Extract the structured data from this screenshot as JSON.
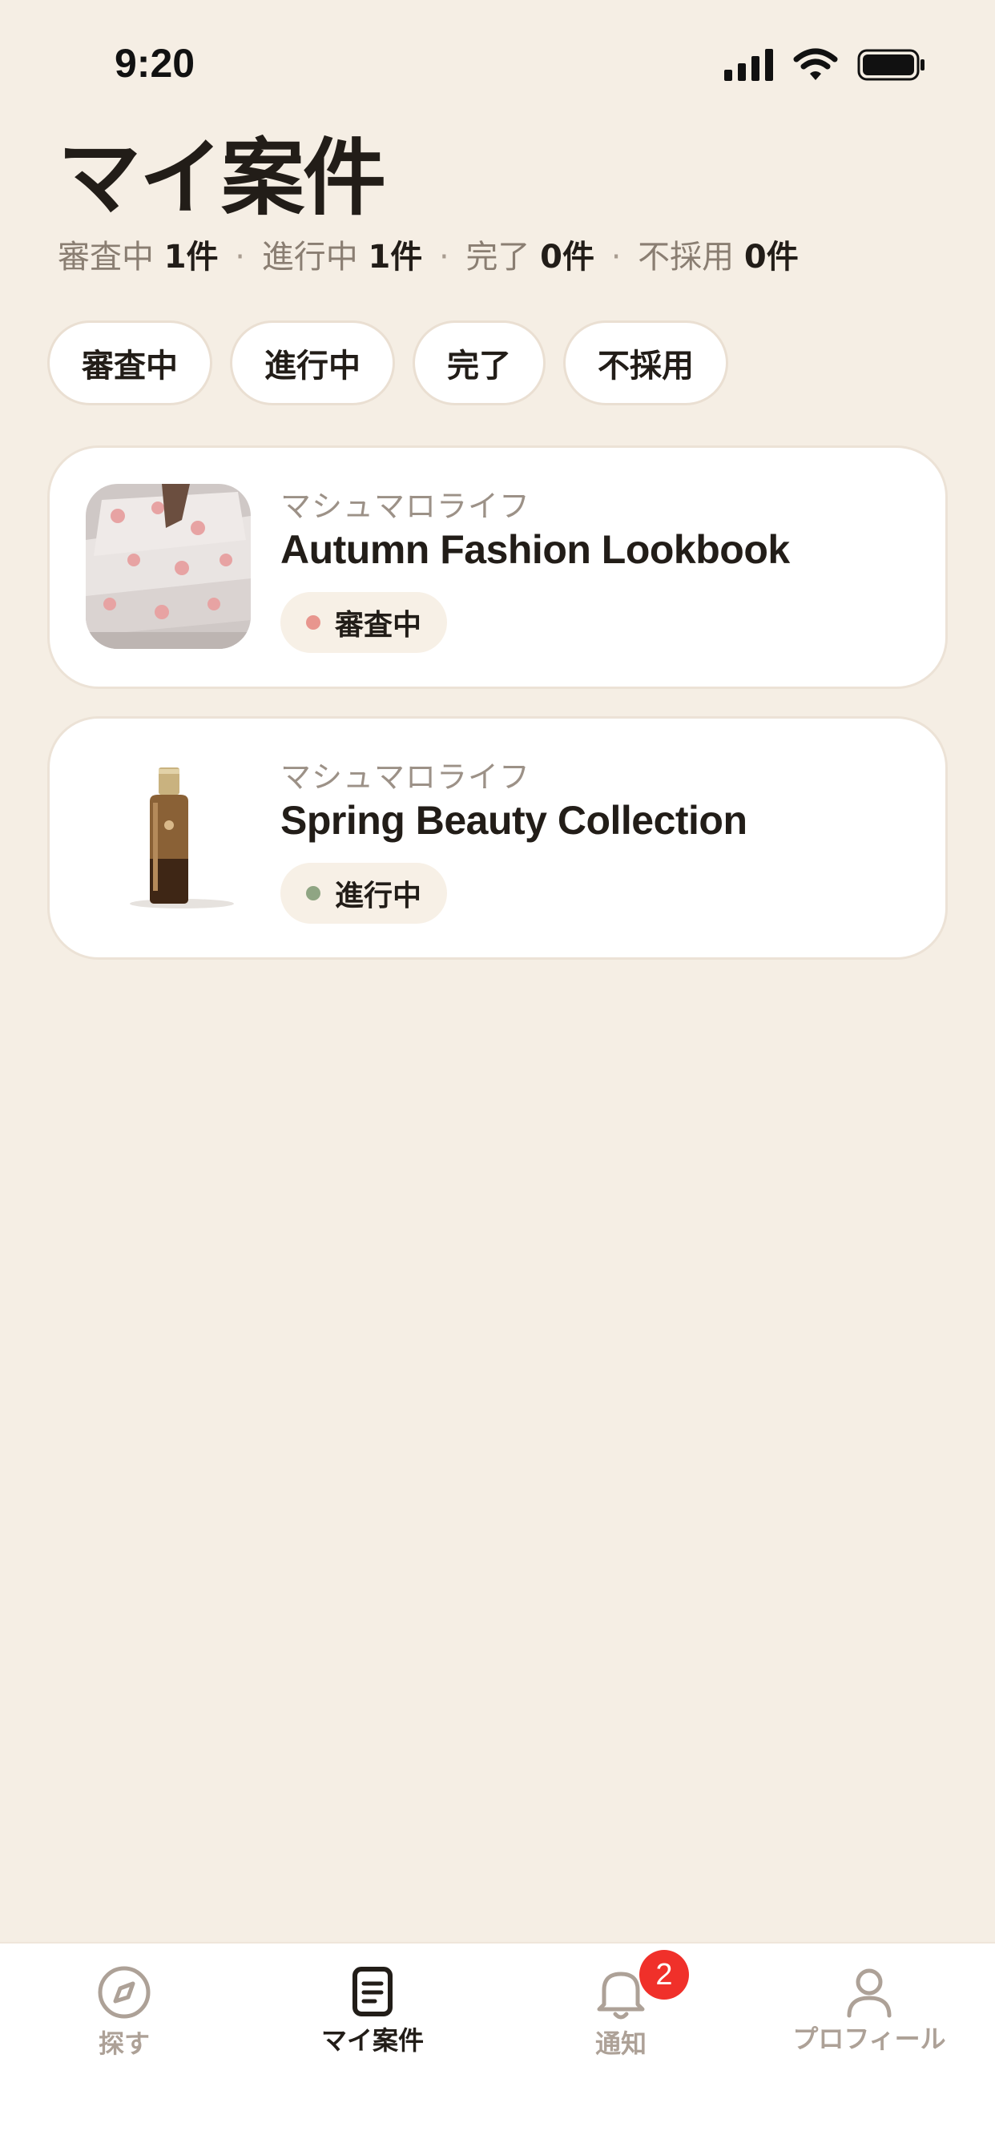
{
  "status_bar": {
    "time": "9:20"
  },
  "page": {
    "title": "マイ案件",
    "summary": [
      {
        "label": "審査中",
        "count": "1件"
      },
      {
        "label": "進行中",
        "count": "1件"
      },
      {
        "label": "完了",
        "count": "0件"
      },
      {
        "label": "不採用",
        "count": "0件"
      }
    ],
    "separator": "·"
  },
  "filters": [
    "審査中",
    "進行中",
    "完了",
    "不採用"
  ],
  "cards": [
    {
      "brand": "マシュマロライフ",
      "title": "Autumn Fashion Lookbook",
      "status": "審査中",
      "status_color": "#E8968E"
    },
    {
      "brand": "マシュマロライフ",
      "title": "Spring Beauty Collection",
      "status": "進行中",
      "status_color": "#8FA583"
    }
  ],
  "tabs": [
    {
      "label": "探す",
      "icon": "compass-icon"
    },
    {
      "label": "マイ案件",
      "icon": "document-icon",
      "active": true
    },
    {
      "label": "通知",
      "icon": "bell-icon",
      "badge": "2"
    },
    {
      "label": "プロフィール",
      "icon": "person-icon"
    }
  ]
}
